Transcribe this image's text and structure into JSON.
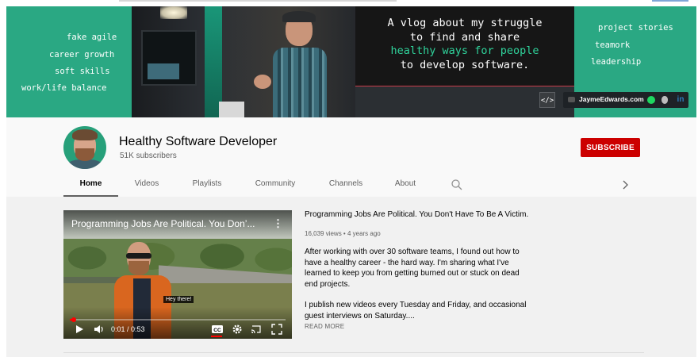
{
  "banner": {
    "left_tags": [
      "fake agile",
      "career growth",
      "soft skills",
      "work/life balance"
    ],
    "right_tags": [
      "project stories",
      "teamork",
      "leadership"
    ],
    "headline_line1": "A vlog about my struggle",
    "headline_line2": "to find and share",
    "headline_highlight": "healthy ways for people",
    "headline_line4": "to develop software.",
    "code_badge": "</>",
    "site_link": "JaymeEdwards.com",
    "linkedin": "in",
    "colors": {
      "banner_green": "#2aa883",
      "highlight_green": "#2fd39b"
    }
  },
  "channel": {
    "name": "Healthy Software Developer",
    "subscribers": "51K subscribers",
    "subscribe_label": "SUBSCRIBE",
    "subscribe_color": "#cc0000"
  },
  "tabs": [
    {
      "label": "Home",
      "active": true
    },
    {
      "label": "Videos",
      "active": false
    },
    {
      "label": "Playlists",
      "active": false
    },
    {
      "label": "Community",
      "active": false
    },
    {
      "label": "Channels",
      "active": false
    },
    {
      "label": "About",
      "active": false
    }
  ],
  "tab_icons": {
    "search": "search-icon",
    "next": "chevron-right-icon"
  },
  "featured_video": {
    "player_title": "Programming Jobs Are Political. You Don’...",
    "overlay_badge": "Hey there!",
    "current_time": "0:01",
    "duration": "0:53",
    "time_display": "0:01 / 0:53",
    "progress_fraction": 0.02,
    "title": "Programming Jobs Are Political. You Don't Have To Be A Victim.",
    "meta": "16,039 views • 4 years ago",
    "description_p1": "After working with over 30 software teams, I found out how to have a healthy career - the hard way. I'm sharing what I've learned to keep you from getting burned out or stuck on dead end projects.",
    "description_p2": "I publish new videos every Tuesday and Friday, and occasional guest interviews on Saturday....",
    "read_more": "READ MORE"
  }
}
